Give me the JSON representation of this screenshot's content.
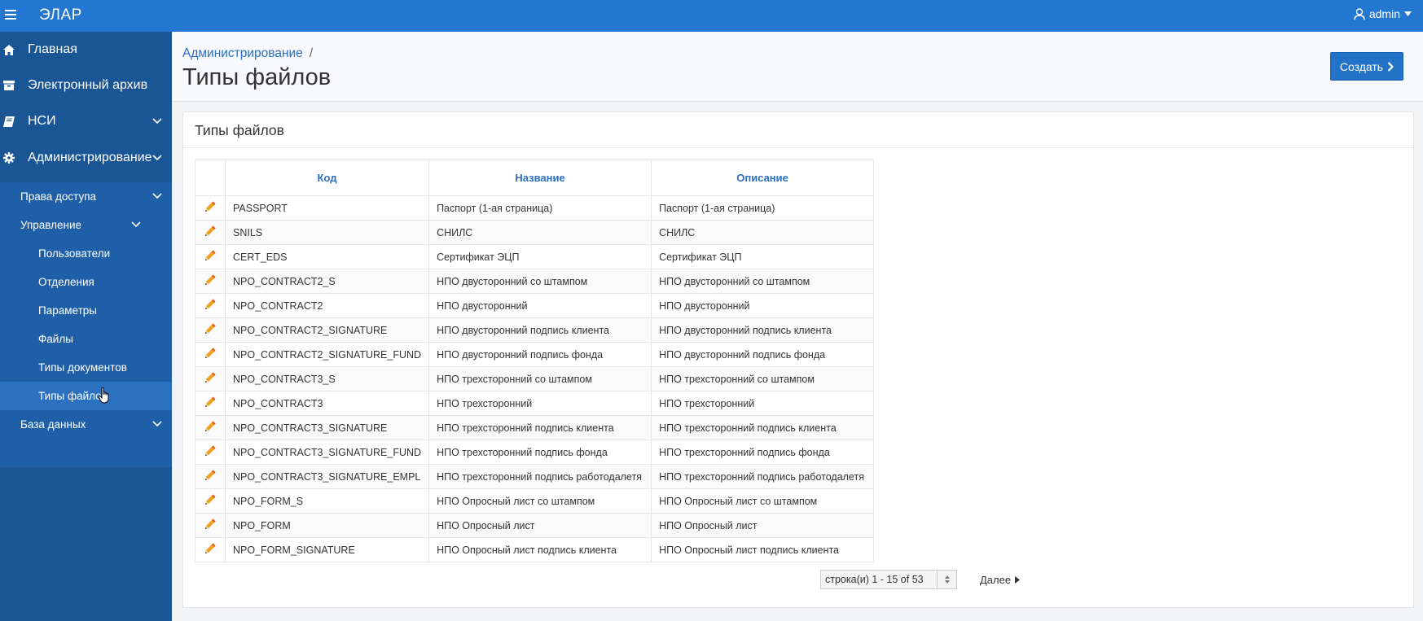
{
  "app": {
    "title": "ЭЛАР",
    "user": "admin"
  },
  "sidebar": {
    "items": [
      {
        "label": "Главная",
        "icon": "home-icon"
      },
      {
        "label": "Электронный архив",
        "icon": "archive-icon"
      },
      {
        "label": "НСИ",
        "icon": "book-icon"
      },
      {
        "label": "Администрирование",
        "icon": "gear-icon"
      }
    ],
    "admin_sub": {
      "access_rights": "Права доступа",
      "management": "Управление",
      "users": "Пользователи",
      "departments": "Отделения",
      "parameters": "Параметры",
      "files": "Файлы",
      "doc_types": "Типы документов",
      "file_types": "Типы файлов",
      "database": "База данных"
    }
  },
  "header": {
    "breadcrumb": "Администрирование",
    "breadcrumb_sep": "/",
    "title": "Типы файлов",
    "create_label": "Создать"
  },
  "region": {
    "title": "Типы файлов"
  },
  "table": {
    "columns": [
      "Код",
      "Название",
      "Описание"
    ],
    "rows": [
      [
        "PASSPORT",
        "Паспорт (1-ая страница)",
        "Паспорт (1-ая страница)"
      ],
      [
        "SNILS",
        "СНИЛС",
        "СНИЛС"
      ],
      [
        "CERT_EDS",
        "Сертификат ЭЦП",
        "Сертификат ЭЦП"
      ],
      [
        "NPO_CONTRACT2_S",
        "НПО двусторонний со штампом",
        "НПО двусторонний со штампом"
      ],
      [
        "NPO_CONTRACT2",
        "НПО двусторонний",
        "НПО двусторонний"
      ],
      [
        "NPO_CONTRACT2_SIGNATURE",
        "НПО двусторонний подпись клиента",
        "НПО двусторонний подпись клиента"
      ],
      [
        "NPO_CONTRACT2_SIGNATURE_FUND",
        "НПО двусторонний подпись фонда",
        "НПО двусторонний подпись фонда"
      ],
      [
        "NPO_CONTRACT3_S",
        "НПО трехсторонний со штампом",
        "НПО трехсторонний со штампом"
      ],
      [
        "NPO_CONTRACT3",
        "НПО трехсторонний",
        "НПО трехсторонний"
      ],
      [
        "NPO_CONTRACT3_SIGNATURE",
        "НПО трехсторонний подпись клиента",
        "НПО трехсторонний подпись клиента"
      ],
      [
        "NPO_CONTRACT3_SIGNATURE_FUND",
        "НПО трехсторонний подпись фонда",
        "НПО трехсторонний подпись фонда"
      ],
      [
        "NPO_CONTRACT3_SIGNATURE_EMPL",
        "НПО трехсторонний подпись работодалетя",
        "НПО трехсторонний подпись работодалетя"
      ],
      [
        "NPO_FORM_S",
        "НПО Опросный лист со штампом",
        "НПО Опросный лист со штампом"
      ],
      [
        "NPO_FORM",
        "НПО Опросный лист",
        "НПО Опросный лист"
      ],
      [
        "NPO_FORM_SIGNATURE",
        "НПО Опросный лист подпись клиента",
        "НПО Опросный лист подпись клиента"
      ]
    ]
  },
  "pagination": {
    "rows_label": "строка(и) 1 - 15 of 53",
    "next_label": "Далее"
  },
  "colors": {
    "topbar": "#2477d0",
    "sidebar": "#1a5595",
    "accent": "#2a6fc1",
    "edit_icon": "#f0a020"
  }
}
